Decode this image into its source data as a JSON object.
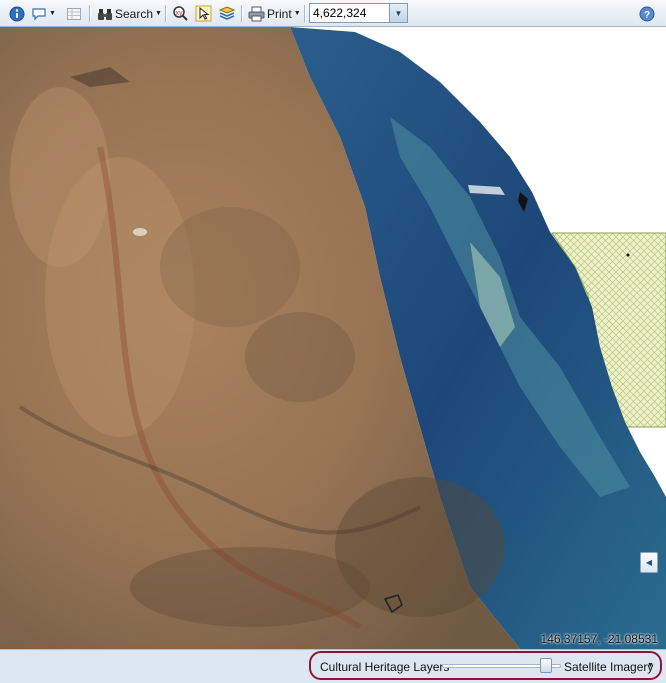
{
  "toolbar": {
    "search_label": "Search",
    "print_label": "Print",
    "scale_value": "4,622,324"
  },
  "map": {
    "coordinates": "146.37157, -21.08531"
  },
  "layer_swipe": {
    "left_layer": "Cultural Heritage Layers",
    "right_layer": "Satellite Imagery",
    "position": 0.92
  },
  "colors": {
    "accent_outline": "#8b1538",
    "toolbar_bg": "#dfe7f1",
    "protected_area_fill": "#e8efbf",
    "ocean": "#1f4f86"
  },
  "icons": {
    "info": "info-icon",
    "comment": "speech-bubble-icon",
    "table": "table-icon",
    "search": "binoculars-icon",
    "measure": "measure-icon",
    "select": "select-cursor-icon",
    "layers": "layers-icon",
    "print": "printer-icon",
    "help": "help-icon"
  }
}
